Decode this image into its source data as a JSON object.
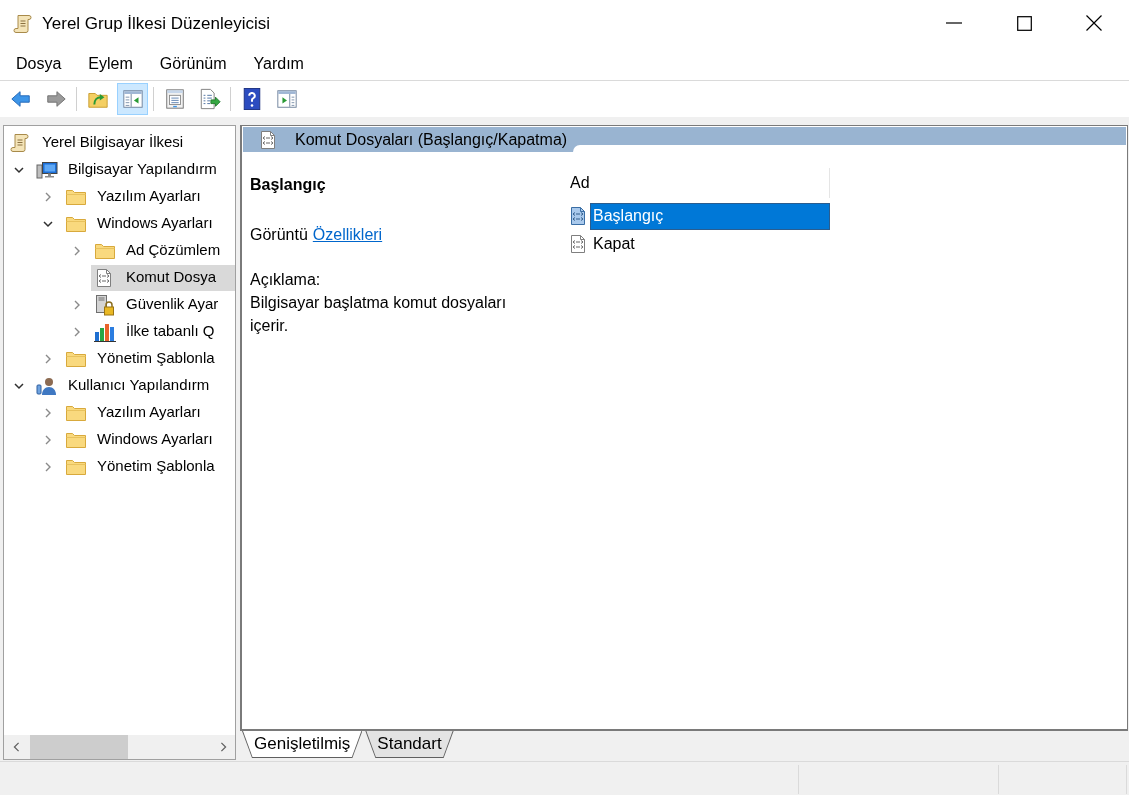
{
  "window": {
    "title": "Yerel Grup İlkesi Düzenleyicisi"
  },
  "menu": [
    "Dosya",
    "Eylem",
    "Görünüm",
    "Yardım"
  ],
  "toolbar": {
    "groups": [
      {
        "buttons": [
          {
            "kind": "back",
            "disabled": false,
            "selected": false
          },
          {
            "kind": "forward",
            "disabled": true,
            "selected": false
          }
        ]
      },
      {
        "buttons": [
          {
            "kind": "up",
            "disabled": false,
            "selected": false
          },
          {
            "kind": "tree",
            "disabled": false,
            "selected": true
          }
        ]
      },
      {
        "buttons": [
          {
            "kind": "properties",
            "disabled": false,
            "selected": false
          },
          {
            "kind": "export",
            "disabled": false,
            "selected": false
          }
        ]
      },
      {
        "buttons": [
          {
            "kind": "help",
            "disabled": false,
            "selected": false
          },
          {
            "kind": "action_pane",
            "disabled": false,
            "selected": false
          }
        ]
      }
    ]
  },
  "tree": {
    "items": [
      {
        "label": "Yerel Bilgisayar İlkesi",
        "kind": "policy",
        "selected": false,
        "children": [
          {
            "label": "Bilgisayar Yapılandırm",
            "kind": "computer",
            "expanded": true,
            "selected": false,
            "children": [
              {
                "label": "Yazılım Ayarları",
                "kind": "folder",
                "expanded": false,
                "selected": false
              },
              {
                "label": "Windows Ayarları",
                "kind": "folder",
                "expanded": true,
                "selected": false,
                "children": [
                  {
                    "label": "Ad Çözümlem",
                    "kind": "folder",
                    "expanded": false,
                    "selected": false
                  },
                  {
                    "label": "Komut Dosya",
                    "kind": "script",
                    "selected": true
                  },
                  {
                    "label": "Güvenlik Ayar",
                    "kind": "security",
                    "expanded": false,
                    "selected": false
                  },
                  {
                    "label": "İlke tabanlı Q",
                    "kind": "chart",
                    "expanded": false,
                    "selected": false
                  }
                ]
              },
              {
                "label": "Yönetim Şablonla",
                "kind": "folder",
                "expanded": false,
                "selected": false
              }
            ]
          },
          {
            "label": "Kullanıcı Yapılandırm",
            "kind": "user",
            "expanded": true,
            "selected": false,
            "children": [
              {
                "label": "Yazılım Ayarları",
                "kind": "folder",
                "expanded": false,
                "selected": false
              },
              {
                "label": "Windows Ayarları",
                "kind": "folder",
                "expanded": false,
                "selected": false
              },
              {
                "label": "Yönetim Şablonla",
                "kind": "folder",
                "expanded": false,
                "selected": false
              }
            ]
          }
        ]
      }
    ]
  },
  "pane": {
    "title": "Komut Dosyaları (Başlangıç/Kapatma)",
    "details": {
      "heading": "Başlangıç",
      "display_label": "Görüntü",
      "display_link": "Özellikleri",
      "description_label": "Açıklama:",
      "description": "Bilgisayar başlatma komut dosyaları içerir."
    },
    "list": {
      "columns": [
        "Ad"
      ],
      "rows": [
        {
          "name": "Başlangıç",
          "selected": true
        },
        {
          "name": "Kapat",
          "selected": false
        }
      ]
    }
  },
  "tabs": [
    {
      "label": "Genişletilmiş",
      "selected": true
    },
    {
      "label": "Standart",
      "selected": false
    }
  ]
}
